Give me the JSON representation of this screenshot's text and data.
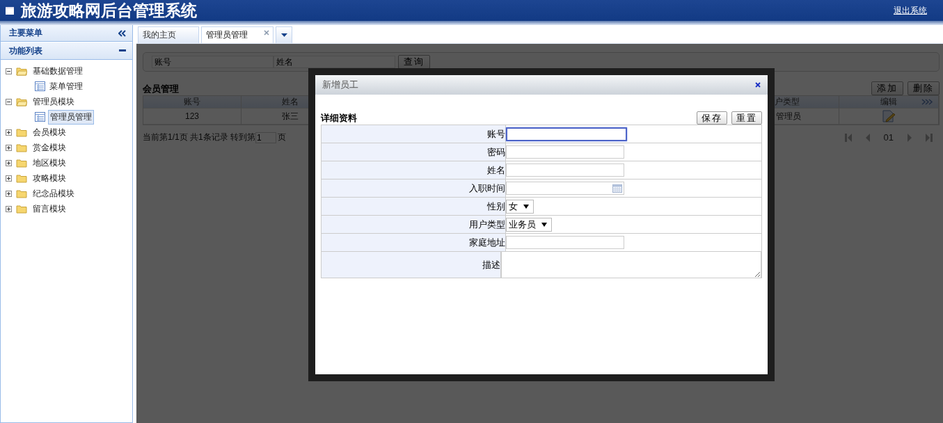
{
  "header": {
    "title": "旅游攻略网后台管理系统",
    "logout": "退出系统"
  },
  "sidebar": {
    "title": "主要菜单",
    "section": "功能列表",
    "tree": [
      {
        "label": "基础数据管理",
        "expanded": true,
        "children": [
          {
            "label": "菜单管理",
            "selected": false
          }
        ]
      },
      {
        "label": "管理员模块",
        "expanded": true,
        "children": [
          {
            "label": "管理员管理",
            "selected": true
          }
        ]
      },
      {
        "label": "会员模块",
        "expanded": false
      },
      {
        "label": "赏金模块",
        "expanded": false
      },
      {
        "label": "地区模块",
        "expanded": false
      },
      {
        "label": "攻略模块",
        "expanded": false
      },
      {
        "label": "纪念品模块",
        "expanded": false
      },
      {
        "label": "留言模块",
        "expanded": false
      }
    ]
  },
  "tabs": [
    {
      "label": "我的主页",
      "selected": false,
      "closable": false
    },
    {
      "label": "管理员管理",
      "selected": true,
      "closable": true
    }
  ],
  "search": {
    "fields": [
      {
        "placeholder": "账号"
      },
      {
        "placeholder": "姓名"
      }
    ],
    "button": "查询"
  },
  "list": {
    "title": "会员管理",
    "buttons": [
      "添加",
      "删除"
    ],
    "columns": [
      "账号",
      "姓名",
      "户类型",
      "编辑"
    ],
    "rows": [
      {
        "cells": [
          "123",
          "张三",
          "管理员"
        ]
      }
    ],
    "pager": {
      "info": "当前第1/1页 共1条记录 转到第",
      "page_input": "1",
      "page_suffix": "页",
      "current": "01"
    }
  },
  "dialog": {
    "title": "新增员工",
    "section": "详细资料",
    "buttons": [
      "保存",
      "重置"
    ],
    "fields": [
      {
        "label": "账号",
        "kind": "text",
        "focused": true
      },
      {
        "label": "密码",
        "kind": "text",
        "focused": false
      },
      {
        "label": "姓名",
        "kind": "text",
        "focused": false
      },
      {
        "label": "入职时间",
        "kind": "date",
        "focused": false
      },
      {
        "label": "性别",
        "kind": "select",
        "value": "女",
        "focused": false
      },
      {
        "label": "用户类型",
        "kind": "select",
        "value": "业务员",
        "focused": false
      },
      {
        "label": "家庭地址",
        "kind": "text",
        "focused": false
      },
      {
        "label": "描述",
        "kind": "textarea",
        "focused": false
      }
    ]
  }
}
